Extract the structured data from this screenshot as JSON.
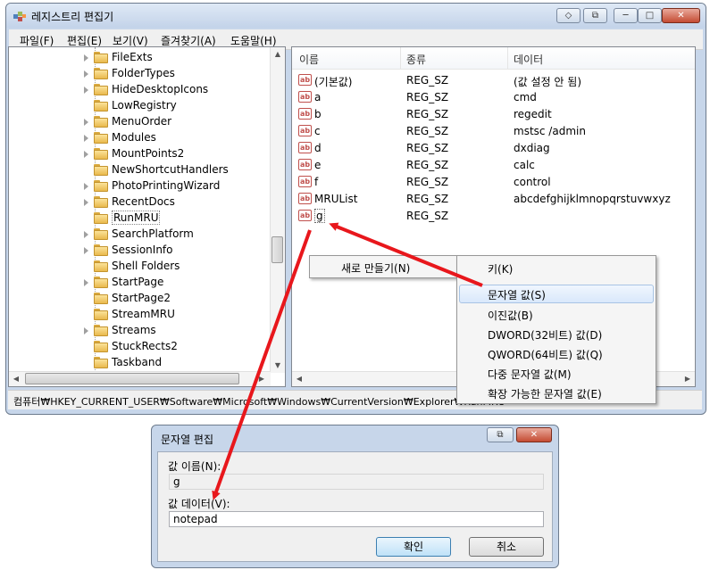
{
  "window": {
    "title": "레지스트리 편집기",
    "caption_buttons": {
      "extra1": "◇",
      "extra2": "⧉",
      "minimize": "─",
      "maximize": "□",
      "close": "✕"
    }
  },
  "menu": [
    "파일(F)",
    "편집(E)",
    "보기(V)",
    "즐겨찾기(A)",
    "도움말(H)"
  ],
  "tree": {
    "items": [
      {
        "label": "FileExts",
        "expandable": true
      },
      {
        "label": "FolderTypes",
        "expandable": true
      },
      {
        "label": "HideDesktopIcons",
        "expandable": true
      },
      {
        "label": "LowRegistry",
        "expandable": false
      },
      {
        "label": "MenuOrder",
        "expandable": true
      },
      {
        "label": "Modules",
        "expandable": true
      },
      {
        "label": "MountPoints2",
        "expandable": true
      },
      {
        "label": "NewShortcutHandlers",
        "expandable": false
      },
      {
        "label": "PhotoPrintingWizard",
        "expandable": true
      },
      {
        "label": "RecentDocs",
        "expandable": true
      },
      {
        "label": "RunMRU",
        "expandable": false,
        "selected": true
      },
      {
        "label": "SearchPlatform",
        "expandable": true
      },
      {
        "label": "SessionInfo",
        "expandable": true
      },
      {
        "label": "Shell Folders",
        "expandable": false
      },
      {
        "label": "StartPage",
        "expandable": true
      },
      {
        "label": "StartPage2",
        "expandable": false
      },
      {
        "label": "StreamMRU",
        "expandable": false
      },
      {
        "label": "Streams",
        "expandable": true
      },
      {
        "label": "StuckRects2",
        "expandable": false
      },
      {
        "label": "Taskband",
        "expandable": false
      }
    ]
  },
  "list": {
    "headers": {
      "name": "이름",
      "type": "종류",
      "data": "데이터"
    },
    "rows": [
      {
        "name": "(기본값)",
        "type": "REG_SZ",
        "data": "(값 설정 안 됨)"
      },
      {
        "name": "a",
        "type": "REG_SZ",
        "data": "cmd"
      },
      {
        "name": "b",
        "type": "REG_SZ",
        "data": "regedit"
      },
      {
        "name": "c",
        "type": "REG_SZ",
        "data": "mstsc /admin"
      },
      {
        "name": "d",
        "type": "REG_SZ",
        "data": "dxdiag"
      },
      {
        "name": "e",
        "type": "REG_SZ",
        "data": "calc"
      },
      {
        "name": "f",
        "type": "REG_SZ",
        "data": "control"
      },
      {
        "name": "MRUList",
        "type": "REG_SZ",
        "data": "abcdefghijklmnopqrstuvwxyz"
      },
      {
        "name": "g",
        "type": "REG_SZ",
        "data": ""
      }
    ],
    "icon_text": "ab"
  },
  "status": {
    "path": "컴퓨터₩HKEY_CURRENT_USER₩Software₩Microsoft₩Windows₩CurrentVersion₩Explorer₩RunMRU"
  },
  "context_menu": {
    "new_label": "새로 만들기(N)",
    "submenu": [
      "키(K)",
      "문자열 값(S)",
      "이진값(B)",
      "DWORD(32비트) 값(D)",
      "QWORD(64비트) 값(Q)",
      "다중 문자열 값(M)",
      "확장 가능한 문자열 값(E)"
    ],
    "highlighted": "문자열 값(S)"
  },
  "dialog": {
    "title": "문자열 편집",
    "value_name_label": "값 이름(N):",
    "value_name": "g",
    "value_data_label": "값 데이터(V):",
    "value_data": "notepad",
    "ok_label": "확인",
    "cancel_label": "취소",
    "close_icon": "⧉"
  },
  "colors": {
    "arrow": "#e8171c",
    "title_bar": "#c7d6ea",
    "highlight": "#d9e8fb"
  }
}
